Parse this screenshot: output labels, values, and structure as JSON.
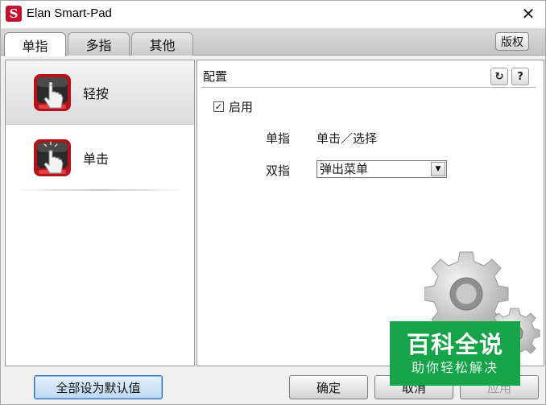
{
  "window": {
    "title": "Elan Smart-Pad",
    "close_glyph": "✕"
  },
  "tabs": [
    {
      "label": "单指",
      "active": true
    },
    {
      "label": "多指",
      "active": false
    },
    {
      "label": "其他",
      "active": false
    }
  ],
  "version_label": "版权",
  "gestures": [
    {
      "label": "轻按",
      "selected": true,
      "icon": "tap-hand-icon"
    },
    {
      "label": "单击",
      "selected": false,
      "icon": "click-hand-icon"
    }
  ],
  "config": {
    "title": "配置",
    "refresh_glyph": "↻",
    "help_glyph": "?",
    "enable_label": "启用",
    "enable_checked": true,
    "single_finger_label": "单指",
    "single_finger_value": "单击／选择",
    "two_finger_label": "双指",
    "two_finger_value": "弹出菜单"
  },
  "buttons": {
    "reset_all": "全部设为默认值",
    "ok": "确定",
    "cancel": "取消",
    "apply": "应用"
  },
  "watermark": {
    "main": "百科全说",
    "sub": "助你轻松解决"
  },
  "colors": {
    "accent_red": "#c8102e",
    "watermark_green": "#16a34a"
  }
}
